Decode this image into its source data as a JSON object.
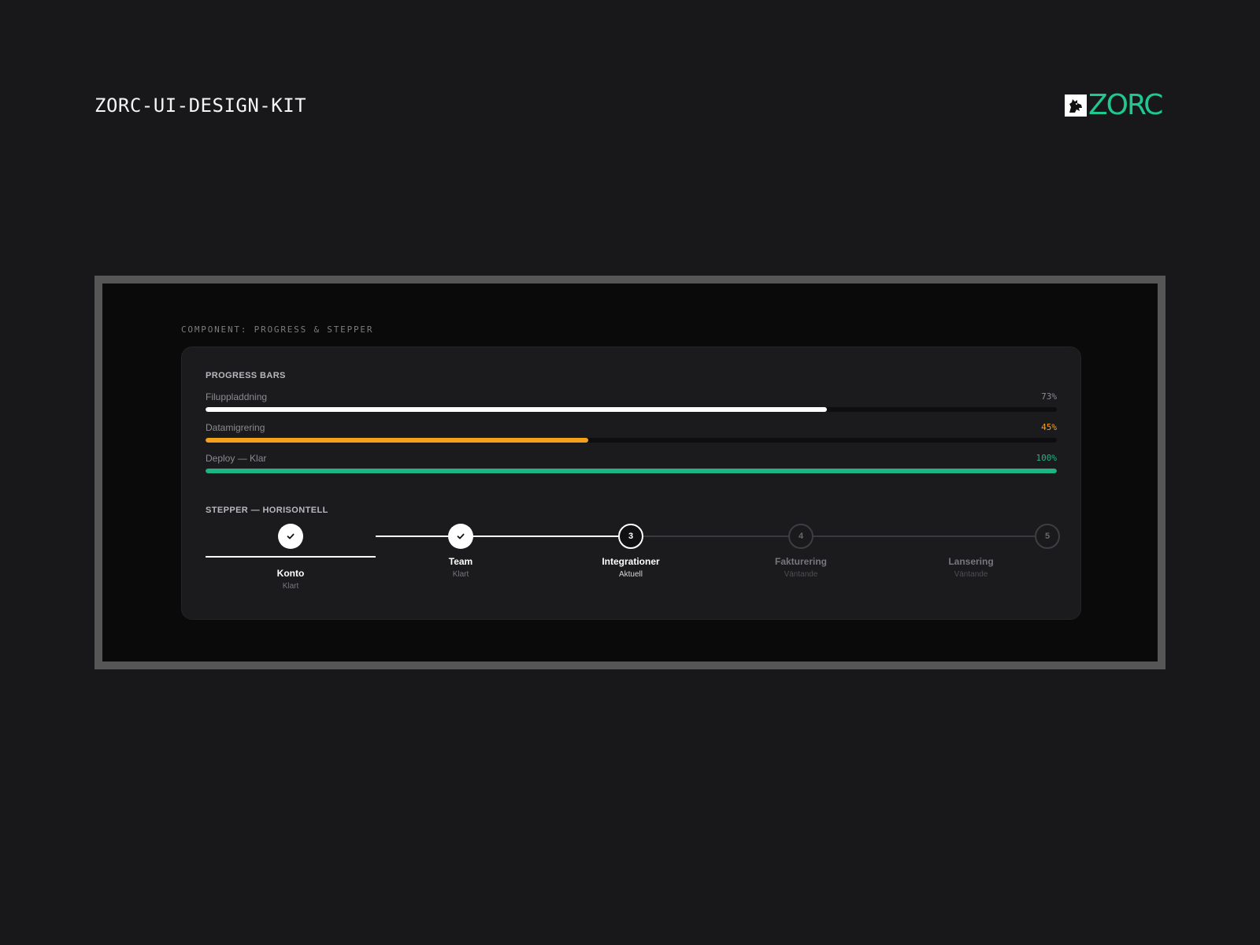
{
  "header": {
    "kit_title": "ZORC-UI-DESIGN-KIT",
    "brand_name": "ZORC",
    "brand_color": "#1fc98e"
  },
  "component_label": "COMPONENT: PROGRESS & STEPPER",
  "progress": {
    "heading": "PROGRESS BARS",
    "bars": [
      {
        "label": "Filuppladdning",
        "value_text": "73%",
        "fraction": 0.73,
        "color": "#ffffff",
        "value_color": "#8b8b90"
      },
      {
        "label": "Datamigrering",
        "value_text": "45%",
        "fraction": 0.45,
        "color": "#f5a01a",
        "value_color": "#f5a01a"
      },
      {
        "label": "Deploy — Klar",
        "value_text": "100%",
        "fraction": 1.0,
        "color": "#1db584",
        "value_color": "#1db584"
      }
    ]
  },
  "stepper": {
    "heading": "STEPPER — HORISONTELL",
    "steps": [
      {
        "number": "1",
        "name": "Konto",
        "status": "Klart",
        "state": "done",
        "selected": true
      },
      {
        "number": "2",
        "name": "Team",
        "status": "Klart",
        "state": "done",
        "selected": false
      },
      {
        "number": "3",
        "name": "Integrationer",
        "status": "Aktuell",
        "state": "current",
        "selected": false
      },
      {
        "number": "4",
        "name": "Fakturering",
        "status": "Väntande",
        "state": "pending",
        "selected": false
      },
      {
        "number": "5",
        "name": "Lansering",
        "status": "Väntande",
        "state": "pending",
        "selected": false
      }
    ]
  }
}
